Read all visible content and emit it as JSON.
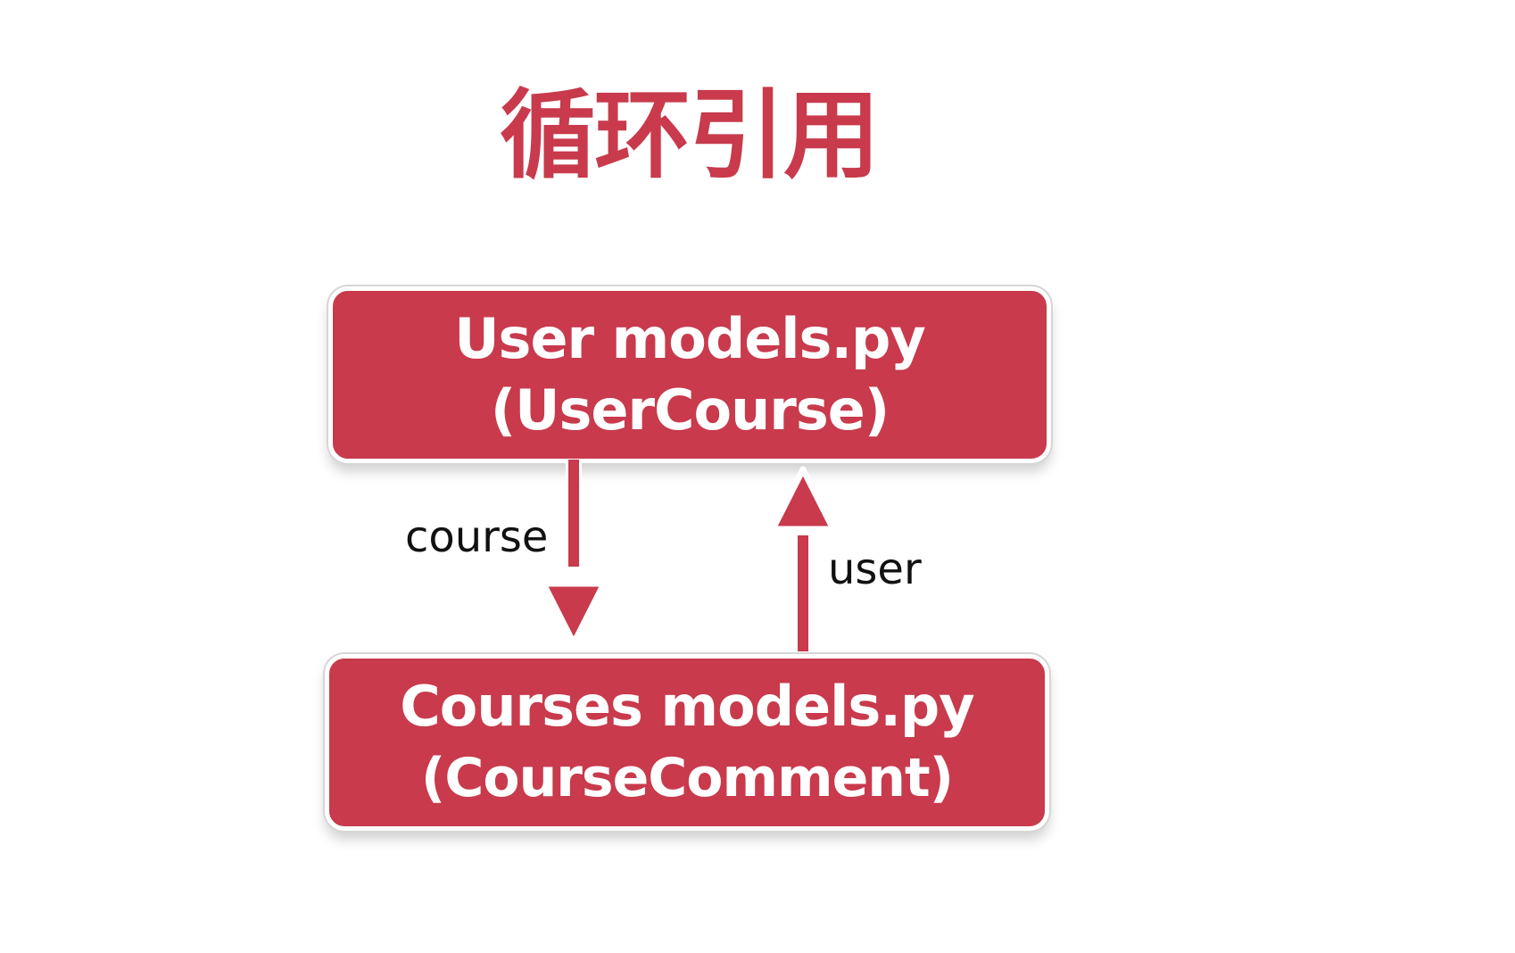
{
  "title": "循环引用",
  "colors": {
    "accent": "#c83a4c",
    "box_fill": "#c83a4c",
    "box_text": "#ffffff",
    "label_text": "#111111",
    "outline": "#ffffff"
  },
  "diagram": {
    "nodes": [
      {
        "id": "user-models",
        "line1": "User models.py",
        "line2": "(UserCourse)"
      },
      {
        "id": "courses-models",
        "line1": "Courses models.py",
        "line2": "(CourseComment)"
      }
    ],
    "edges": [
      {
        "from": "user-models",
        "to": "courses-models",
        "label": "course"
      },
      {
        "from": "courses-models",
        "to": "user-models",
        "label": "user"
      }
    ]
  }
}
